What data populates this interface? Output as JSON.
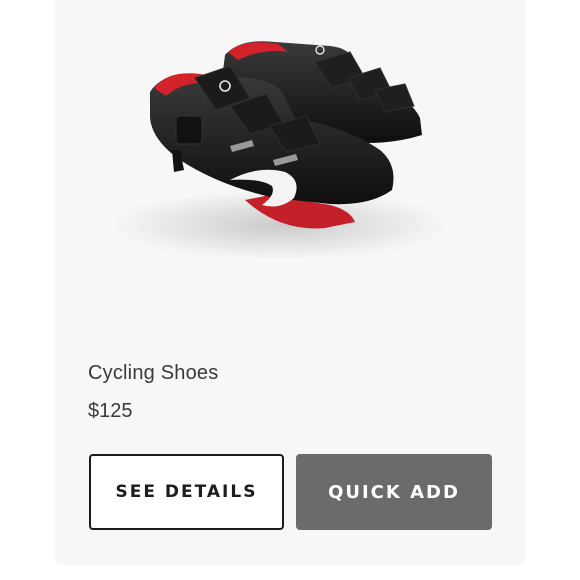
{
  "product": {
    "name": "Cycling Shoes",
    "price": "$125"
  },
  "actions": {
    "details_label": "SEE DETAILS",
    "quick_add_label": "QUICK ADD"
  },
  "colors": {
    "card_background": "#f7f7f7",
    "quick_add_background": "#6b6b6d",
    "details_border": "#1c1c1c",
    "shoe_black": "#151515",
    "shoe_red": "#d3222a"
  }
}
